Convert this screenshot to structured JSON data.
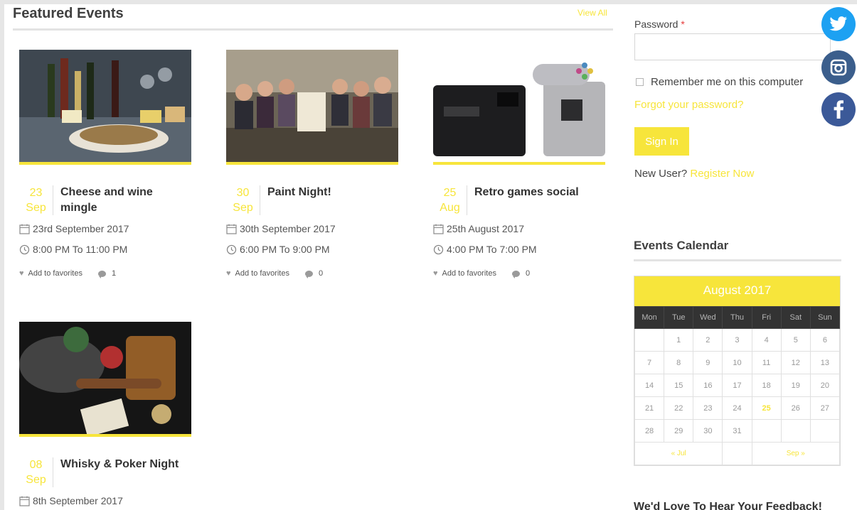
{
  "featured": {
    "title": "Featured Events",
    "view_all": "View All"
  },
  "events": [
    {
      "day": "23",
      "month": "Sep",
      "title": "Cheese and wine mingle",
      "date": "23rd September 2017",
      "time": "8:00 PM To 11:00 PM",
      "favorites": "Add to favorites",
      "comments": "1"
    },
    {
      "day": "30",
      "month": "Sep",
      "title": "Paint Night!",
      "date": "30th September 2017",
      "time": "6:00 PM To 9:00 PM",
      "favorites": "Add to favorites",
      "comments": "0"
    },
    {
      "day": "25",
      "month": "Aug",
      "title": "Retro games social",
      "date": "25th August 2017",
      "time": "4:00 PM To 7:00 PM",
      "favorites": "Add to favorites",
      "comments": "0"
    },
    {
      "day": "08",
      "month": "Sep",
      "title": "Whisky & Poker Night",
      "date": "8th September 2017"
    }
  ],
  "login": {
    "password_label": "Password",
    "required_mark": "*",
    "remember_label": "Remember me on this computer",
    "forgot": "Forgot your password?",
    "sign_in": "Sign In",
    "new_user": "New User?",
    "register": "Register Now"
  },
  "calendar": {
    "section_title": "Events Calendar",
    "month_label": "August 2017",
    "weekdays": [
      "Mon",
      "Tue",
      "Wed",
      "Thu",
      "Fri",
      "Sat",
      "Sun"
    ],
    "weeks": [
      [
        "",
        "1",
        "2",
        "3",
        "4",
        "5",
        "6"
      ],
      [
        "7",
        "8",
        "9",
        "10",
        "11",
        "12",
        "13"
      ],
      [
        "14",
        "15",
        "16",
        "17",
        "18",
        "19",
        "20"
      ],
      [
        "21",
        "22",
        "23",
        "24",
        "25",
        "26",
        "27"
      ],
      [
        "28",
        "29",
        "30",
        "31",
        "",
        "",
        ""
      ]
    ],
    "highlighted_day": "25",
    "prev": "« Jul",
    "next": "Sep »"
  },
  "feedback_title": "We'd Love To Hear Your Feedback!",
  "colors": {
    "accent": "#f7e53b",
    "twitter": "#1da1f2",
    "instagram": "#3b5e8c",
    "facebook": "#3b5998"
  },
  "social_icons": [
    "twitter-icon",
    "instagram-icon",
    "facebook-icon"
  ]
}
